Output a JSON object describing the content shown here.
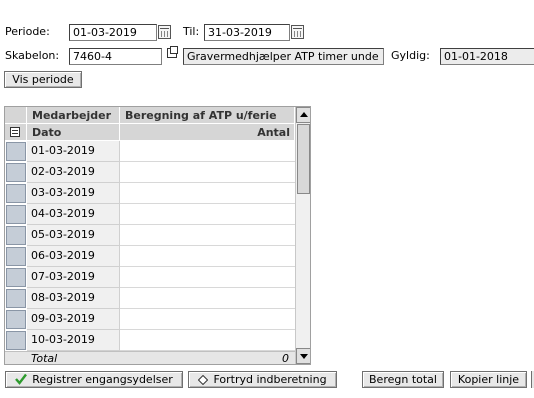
{
  "periode": {
    "label": "Periode:",
    "from": "01-03-2019",
    "til_label": "Til:",
    "to": "31-03-2019"
  },
  "skabelon": {
    "label": "Skabelon:",
    "code": "7460-4",
    "name": "Gravermedhjælper ATP timer unde",
    "gyldig_label": "Gyldig:",
    "gyldig": "01-01-2018"
  },
  "vis_periode": "Vis periode",
  "grid": {
    "header1": {
      "col1": "Medarbejder",
      "col2": "Beregning af ATP u/ferie"
    },
    "header2": {
      "col1": "Dato",
      "col2": "Antal"
    },
    "rows": [
      {
        "date": "01-03-2019",
        "value": ""
      },
      {
        "date": "02-03-2019",
        "value": ""
      },
      {
        "date": "03-03-2019",
        "value": ""
      },
      {
        "date": "04-03-2019",
        "value": ""
      },
      {
        "date": "05-03-2019",
        "value": ""
      },
      {
        "date": "06-03-2019",
        "value": ""
      },
      {
        "date": "07-03-2019",
        "value": ""
      },
      {
        "date": "08-03-2019",
        "value": ""
      },
      {
        "date": "09-03-2019",
        "value": ""
      },
      {
        "date": "10-03-2019",
        "value": ""
      }
    ],
    "total_label": "Total",
    "total_value": "0"
  },
  "buttons": {
    "registrer": "Registrer engangsydelser",
    "fortryd": "Fortryd indberetning",
    "beregn": "Beregn total",
    "kopier": "Kopier linje"
  },
  "colors": {
    "header_bg": "#d6d6d6",
    "check_green": "#2e9b2e",
    "field_readonly": "#ececec"
  }
}
